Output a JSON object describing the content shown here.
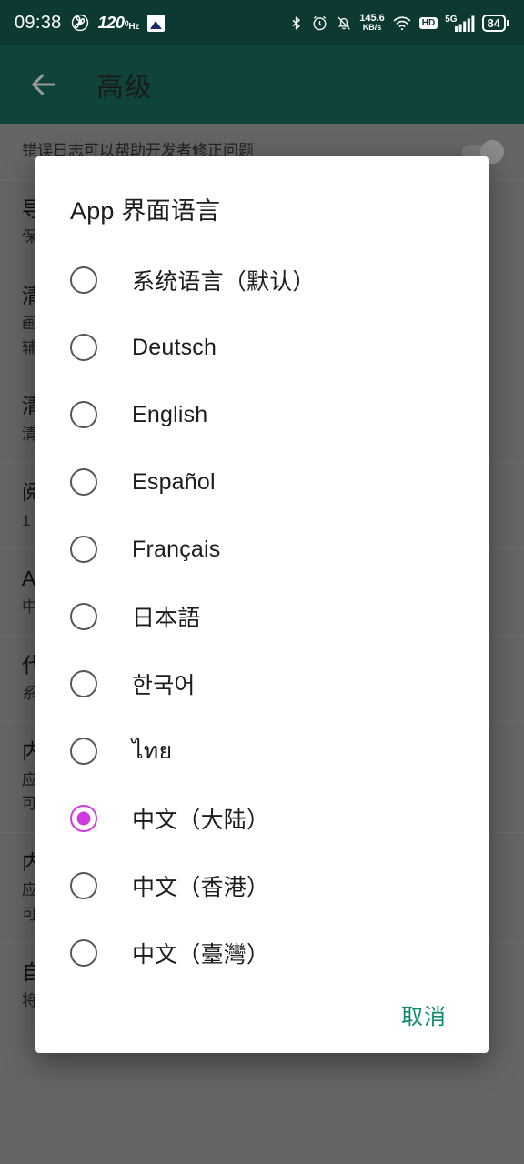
{
  "status_bar": {
    "time": "09:38",
    "refresh_rate": "120",
    "refresh_rate_unit": "Hz",
    "refresh_rate_sup": "0",
    "network_speed_value": "145.6",
    "network_speed_unit": "KB/s",
    "hd_label": "HD",
    "network_type": "5G",
    "battery_level": "84",
    "icons": [
      "fan-icon",
      "image-icon",
      "bluetooth-icon",
      "alarm-icon",
      "bell-muted-icon",
      "wifi-icon",
      "hd-icon",
      "signal-bars-icon",
      "battery-icon"
    ],
    "background_color": "#0c3a32"
  },
  "app_bar": {
    "title": "高级",
    "back_icon": "arrow-left-icon",
    "background_color": "#0e443b"
  },
  "background_settings": {
    "rows": [
      {
        "title": "",
        "subtitle": "错误日志可以帮助开发者修正问题",
        "has_toggle": true
      },
      {
        "title": "导出日志",
        "subtitle": "保存日志到文件",
        "has_toggle": false
      },
      {
        "title": "清理缓存",
        "subtitle": "画质缓存",
        "subtitle2": "辅助缓存数据",
        "has_toggle": false
      },
      {
        "title": "清理数据",
        "subtitle": "清除全部应用数据",
        "has_toggle": false
      },
      {
        "title": "阅读模式",
        "subtitle": "1",
        "has_toggle": false
      },
      {
        "title": "App 界面语言",
        "subtitle": "中文（大陆）",
        "has_toggle": false
      },
      {
        "title": "代理服务器",
        "subtitle": "系统代理",
        "has_toggle": false
      },
      {
        "title": "内置 hosts.txt",
        "subtitle": "应用内置的 hosts 规则",
        "subtitle2": "可被自定义 hosts.txt 覆盖",
        "has_toggle": false
      },
      {
        "title": "内置 hosts.txt",
        "subtitle": "应用内置的 hosts 规则",
        "subtitle2": "可被自定义 hosts.txt 覆盖",
        "has_toggle": false
      },
      {
        "title": "自定义 hosts.txt",
        "subtitle": "将主机名称映射到相应的IP地址",
        "has_toggle": false
      }
    ]
  },
  "dialog": {
    "title": "App 界面语言",
    "selected_index": 8,
    "accent_color": "#d13ae0",
    "options": [
      {
        "label": "系统语言（默认）"
      },
      {
        "label": "Deutsch"
      },
      {
        "label": "English"
      },
      {
        "label": "Español"
      },
      {
        "label": "Français"
      },
      {
        "label": "日本語"
      },
      {
        "label": "한국어"
      },
      {
        "label": "ไทย"
      },
      {
        "label": "中文（大陆）"
      },
      {
        "label": "中文（香港）"
      },
      {
        "label": "中文（臺灣）"
      }
    ],
    "cancel_label": "取消",
    "cancel_color": "#0f8a72"
  }
}
